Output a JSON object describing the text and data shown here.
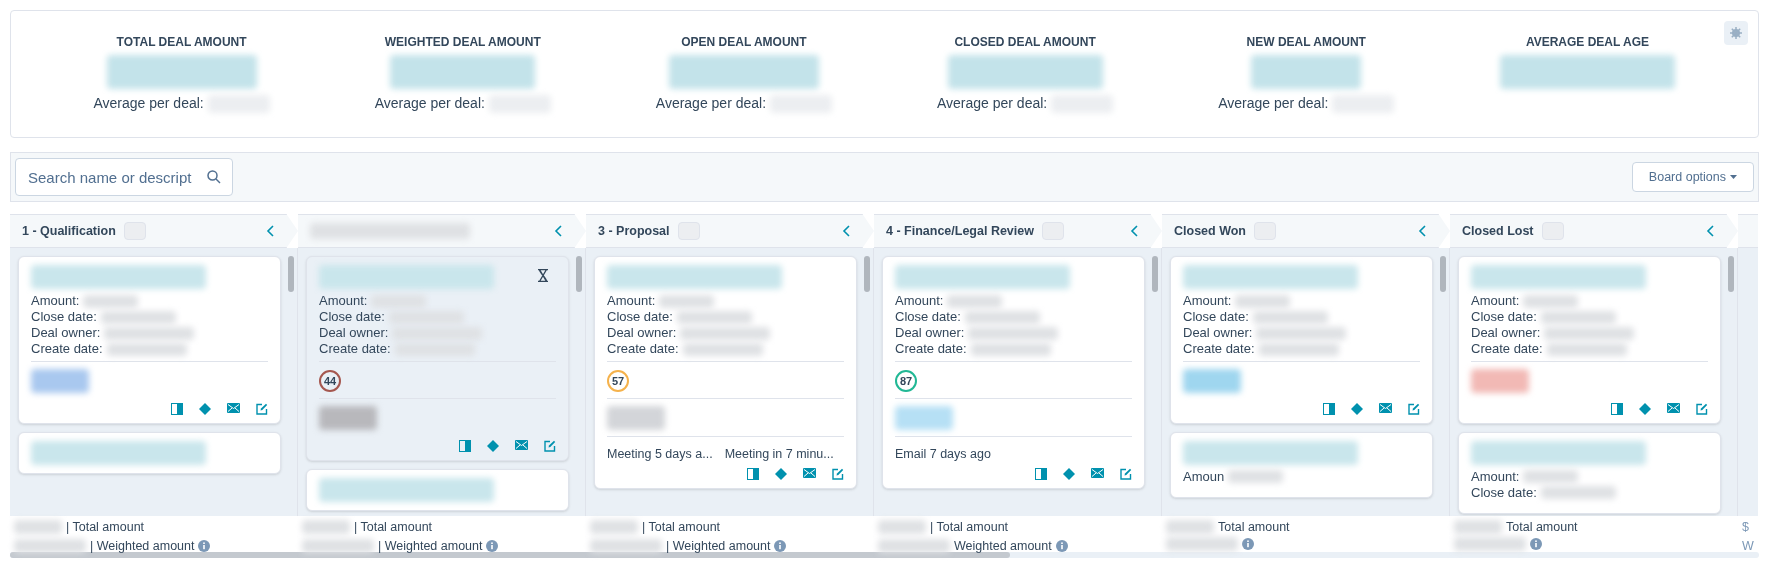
{
  "stats": [
    {
      "label": "TOTAL DEAL AMOUNT",
      "average_label": "Average per deal:"
    },
    {
      "label": "WEIGHTED DEAL AMOUNT",
      "average_label": "Average per deal:"
    },
    {
      "label": "OPEN DEAL AMOUNT",
      "average_label": "Average per deal:"
    },
    {
      "label": "CLOSED DEAL AMOUNT",
      "average_label": "Average per deal:"
    },
    {
      "label": "NEW DEAL AMOUNT",
      "average_label": "Average per deal:"
    },
    {
      "label": "AVERAGE DEAL AGE"
    }
  ],
  "search": {
    "placeholder": "Search name or descript"
  },
  "board_options": "Board options",
  "columns": [
    {
      "title": "1 - Qualification",
      "cards": [
        {
          "kind": "full",
          "selected": false,
          "fields": [
            "Amount:",
            "Close date:",
            "Deal owner:",
            "Create date:"
          ]
        },
        {
          "kind": "partial",
          "selected": false
        }
      ],
      "total_label": "| Total amount",
      "weighted_label": "| Weighted amount"
    },
    {
      "cards": [
        {
          "kind": "full",
          "selected": true,
          "hourglass": true,
          "fields": [
            "Amount:",
            "Close date:",
            "Deal owner:",
            "Create date:"
          ],
          "score": {
            "value": "44",
            "color": "#a5574f"
          }
        },
        {
          "kind": "partial",
          "selected": false
        }
      ],
      "total_label": "| Total amount",
      "weighted_label": "| Weighted amount"
    },
    {
      "title": "3 - Proposal",
      "cards": [
        {
          "kind": "full",
          "selected": false,
          "fields": [
            "Amount:",
            "Close date:",
            "Deal owner:",
            "Create date:"
          ],
          "score": {
            "value": "57",
            "color": "#f5b24c"
          },
          "activities": [
            "Meeting 5 days a...",
            "Meeting in 7 minu..."
          ]
        }
      ],
      "total_label": "| Total amount",
      "weighted_label": "| Weighted amount"
    },
    {
      "title": "4 - Finance/Legal Review",
      "cards": [
        {
          "kind": "full",
          "selected": false,
          "fields": [
            "Amount:",
            "Close date:",
            "Deal owner:",
            "Create date:"
          ],
          "score": {
            "value": "87",
            "color": "#21b895"
          },
          "activities": [
            "Email 7 days ago"
          ]
        }
      ],
      "total_label": "| Total amount",
      "weighted_label": "Weighted amount"
    },
    {
      "title": "Closed Won",
      "cards": [
        {
          "kind": "full",
          "selected": false,
          "fields": [
            "Amount:",
            "Close date:",
            "Deal owner:",
            "Create date:"
          ]
        },
        {
          "kind": "partial",
          "selected": false,
          "fields": [
            "Amoun"
          ]
        }
      ],
      "total_label": "Total amount"
    },
    {
      "title": "Closed Lost",
      "cards": [
        {
          "kind": "full",
          "selected": false,
          "fields": [
            "Amount:",
            "Close date:",
            "Deal owner:",
            "Create date:"
          ]
        },
        {
          "kind": "partial",
          "selected": false,
          "fields": [
            "Amount:",
            "Close date:"
          ]
        }
      ],
      "total_label": "Total amount"
    }
  ],
  "partial_column": {
    "total_label": "$",
    "weighted_label": "W"
  }
}
